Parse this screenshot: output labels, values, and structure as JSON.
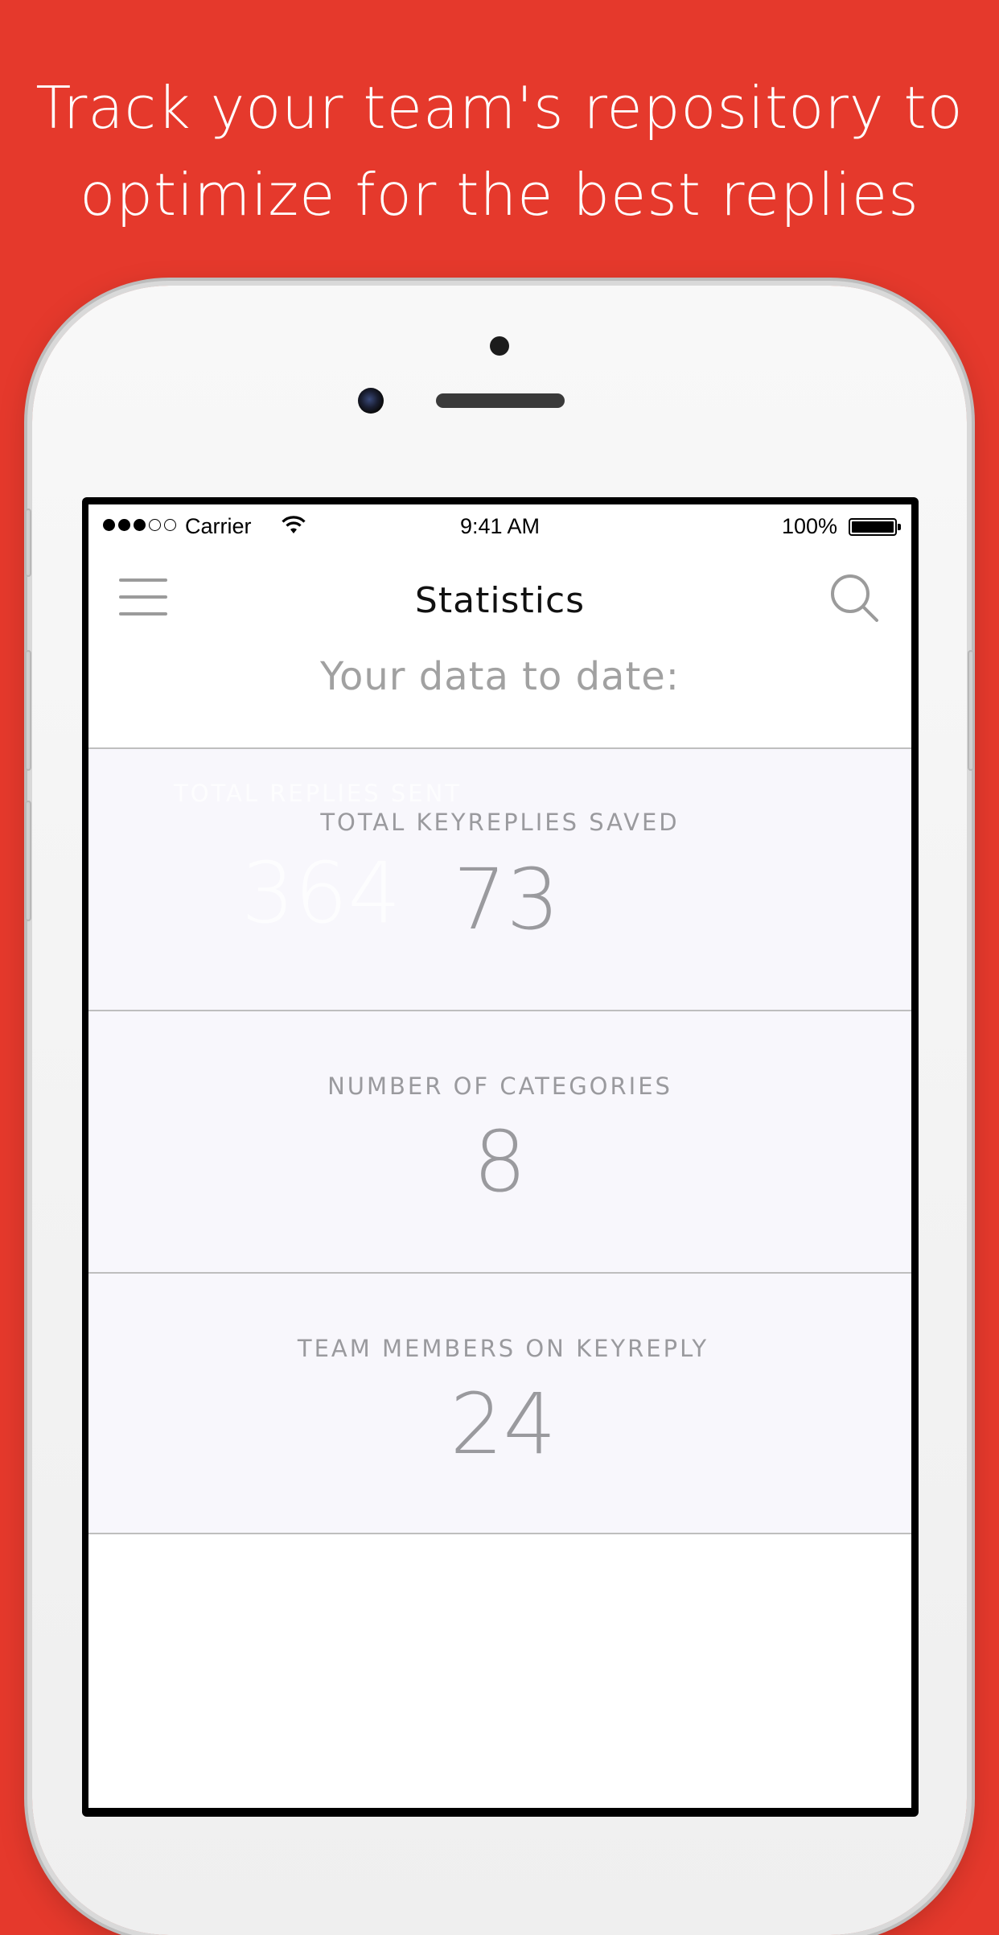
{
  "headline": {
    "line1": "Track your team's repository to",
    "line2": "optimize for the best replies"
  },
  "status_bar": {
    "carrier": "Carrier",
    "time": "9:41 AM",
    "battery": "100%"
  },
  "nav": {
    "title": "Statistics",
    "menu_icon": "hamburger-menu-icon",
    "search_icon": "search-icon"
  },
  "subtitle": "Your data to date:",
  "stats": [
    {
      "label": "TOTAL KEYREPLIES SAVED",
      "value": "73",
      "ghost_label": "TOTAL REPLIES SENT",
      "ghost_value": "364"
    },
    {
      "label": "NUMBER OF CATEGORIES",
      "value": "8"
    },
    {
      "label": "TEAM MEMBERS ON KEYREPLY",
      "value": "24"
    }
  ],
  "colors": {
    "background": "#e5392c",
    "stat_text": "#9a9a9e",
    "card_bg": "#f8f7fc"
  }
}
